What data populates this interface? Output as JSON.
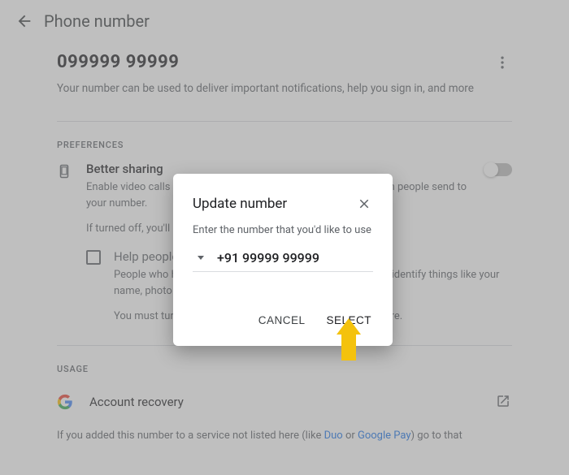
{
  "header": {
    "title": "Phone number"
  },
  "number": {
    "value": "099999  99999",
    "description": "Your number can be used to deliver important notifications, help you sign in, and more"
  },
  "preferences": {
    "section_label": "PREFERENCES",
    "better_sharing": {
      "title": "Better sharing",
      "desc": "Enable video calls and other sharing across Google services when people send to your number.",
      "off_note": "If turned off, you'll lose these features."
    },
    "help_people": {
      "title": "Help people find you",
      "desc": "People who have your number use it to find you, photo, and identify things like your name, photo and reviews on Maps & content.",
      "share_note": "You must turn on better sharing on Google to use this feature."
    }
  },
  "usage": {
    "section_label": "USAGE",
    "items": [
      {
        "label": "Account recovery"
      }
    ],
    "footnote_pre": "If you added this number to a service not listed here (like ",
    "footnote_link1": "Duo",
    "footnote_mid": " or ",
    "footnote_link2": "Google Pay",
    "footnote_post": ") go to that"
  },
  "dialog": {
    "title": "Update number",
    "prompt": "Enter the number that you'd like to use",
    "phone_value": "+91 99999 99999",
    "cancel": "CANCEL",
    "select": "SELECT"
  }
}
